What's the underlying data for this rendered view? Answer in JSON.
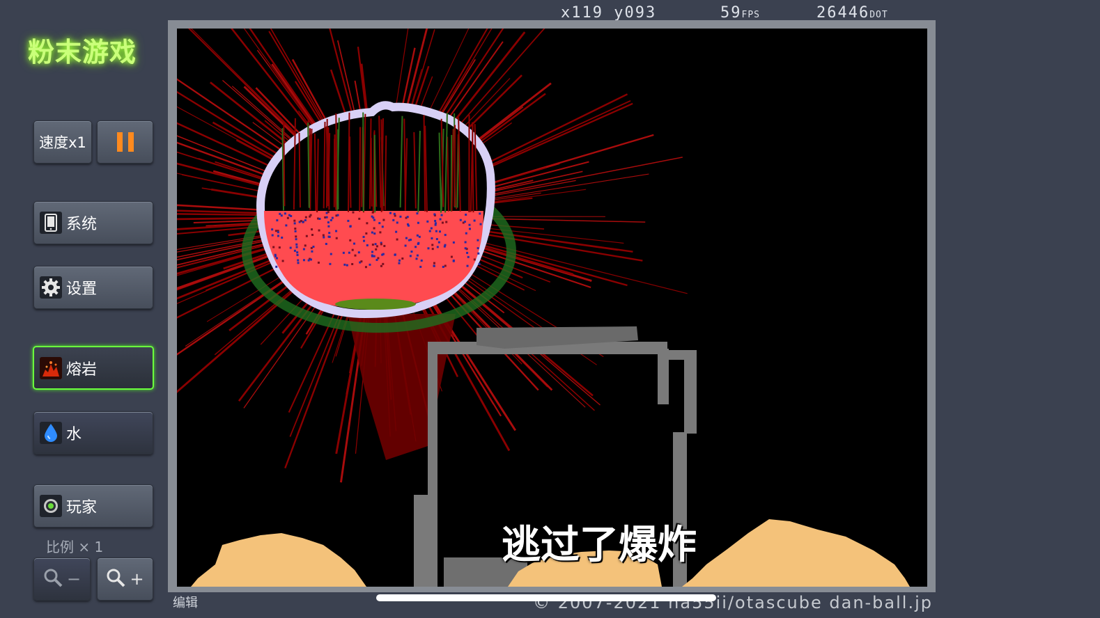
{
  "app": {
    "title": "粉末游戏"
  },
  "hud": {
    "x": "x119",
    "y": "y093",
    "fps_value": "59",
    "fps_unit": "FPS",
    "dots_value": "26446",
    "dots_unit": "DOT"
  },
  "controls": {
    "speed_label": "速度x1",
    "menu": [
      {
        "label": "系统",
        "icon": "tablet-icon"
      },
      {
        "label": "设置",
        "icon": "gear-icon"
      }
    ],
    "elements": [
      {
        "label": "熔岩",
        "icon": "lava-icon",
        "selected": true
      },
      {
        "label": "水",
        "icon": "water-drop-icon",
        "selected": false
      },
      {
        "label": "玩家",
        "icon": "player-icon",
        "selected": false
      }
    ],
    "scale_label": "比例 × 1",
    "zoom_out": "−",
    "zoom_in": "+"
  },
  "footer": {
    "edit_label": "编辑",
    "copyright": "© 2007-2021 ha55ii/otascube dan-ball.jp"
  },
  "subtitle": "逃过了爆炸",
  "colors": {
    "accent_green": "#6bff3d",
    "lava": "#ff4b4b",
    "dark_red": "#8a0000",
    "sand": "#f4c27a",
    "wall": "#7a7a7a",
    "glass": "#d8d0f6"
  }
}
